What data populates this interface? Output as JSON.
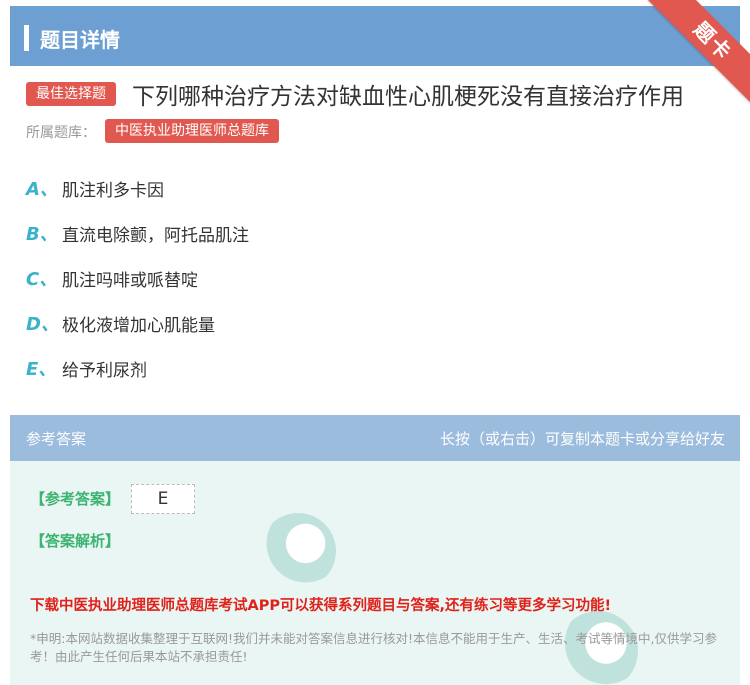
{
  "header": {
    "title": "题目详情"
  },
  "ribbon": {
    "label": "题卡"
  },
  "question": {
    "type_badge": "最佳选择题",
    "text": "下列哪种治疗方法对缺血性心肌梗死没有直接治疗作用",
    "bank_label": "所属题库：",
    "bank_name": "中医执业助理医师总题库"
  },
  "options": [
    {
      "letter": "A、",
      "text": "肌注利多卡因"
    },
    {
      "letter": "B、",
      "text": "直流电除颤，阿托品肌注"
    },
    {
      "letter": "C、",
      "text": "肌注吗啡或哌替啶"
    },
    {
      "letter": "D、",
      "text": "极化液增加心肌能量"
    },
    {
      "letter": "E、",
      "text": "给予利尿剂"
    }
  ],
  "answer": {
    "section_title": "参考答案",
    "share_hint": "长按（或右击）可复制本题卡或分享给好友",
    "answer_label": "【参考答案】",
    "answer_value": "E",
    "analysis_label": "【答案解析】",
    "promo": "下载中医执业助理医师总题库考试APP可以获得系列题目与答案,还有练习等更多学习功能!",
    "disclaimer": "*申明:本网站数据收集整理于互联网!我们并未能对答案信息进行核对!本信息不能用于生产、生活、考试等情境中,仅供学习参考！由此产生任何后果本站不承担责任!"
  },
  "colors": {
    "header_bg": "#6d9fd3",
    "ribbon_bg": "#e0584f",
    "badge_bg": "#e0584f",
    "option_letter": "#3ab2c9",
    "answer_label": "#3cb371",
    "promo_text": "#e0211a"
  }
}
